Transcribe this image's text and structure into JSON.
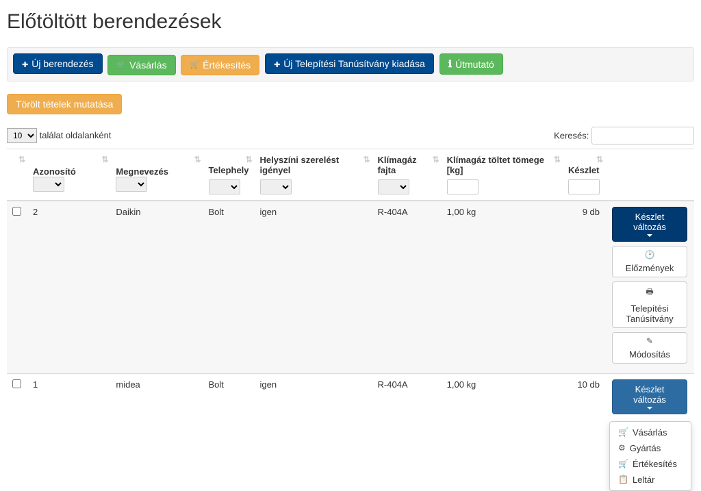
{
  "page_title": "Előtöltött berendezések",
  "toolbar": {
    "new_device": "Új berendezés",
    "purchase": "Vásárlás",
    "sale": "Értékesítés",
    "new_cert": "Új Telepítési Tanúsítvány kiadása",
    "guide": "Útmutató"
  },
  "show_deleted": "Törölt tételek mutatása",
  "length": {
    "selected": "10",
    "suffix": "találat oldalanként"
  },
  "search_label": "Keresés:",
  "columns": {
    "id": "Azonosító",
    "name": "Megnevezés",
    "site": "Telephely",
    "onsite": "Helyszíni szerelést igényel",
    "gas": "Klímagáz fajta",
    "gas_mass": "Klímagáz töltet tömege [kg]",
    "stock": "Készlet"
  },
  "rows": [
    {
      "id": "2",
      "name": "Daikin",
      "site": "Bolt",
      "onsite": "igen",
      "gas": "R-404A",
      "mass": "1,00 kg",
      "stock": "9 db"
    },
    {
      "id": "1",
      "name": "midea",
      "site": "Bolt",
      "onsite": "igen",
      "gas": "R-404A",
      "mass": "1,00 kg",
      "stock": "10 db"
    }
  ],
  "actions": {
    "stock_change": "Készlet változás",
    "history": "Előzmények",
    "install_cert": "Telepítési Tanúsítvány",
    "edit": "Módosítás"
  },
  "dropdown": {
    "purchase": "Vásárlás",
    "manufacture": "Gyártás",
    "sale": "Értékesítés",
    "inventory": "Leltár"
  }
}
